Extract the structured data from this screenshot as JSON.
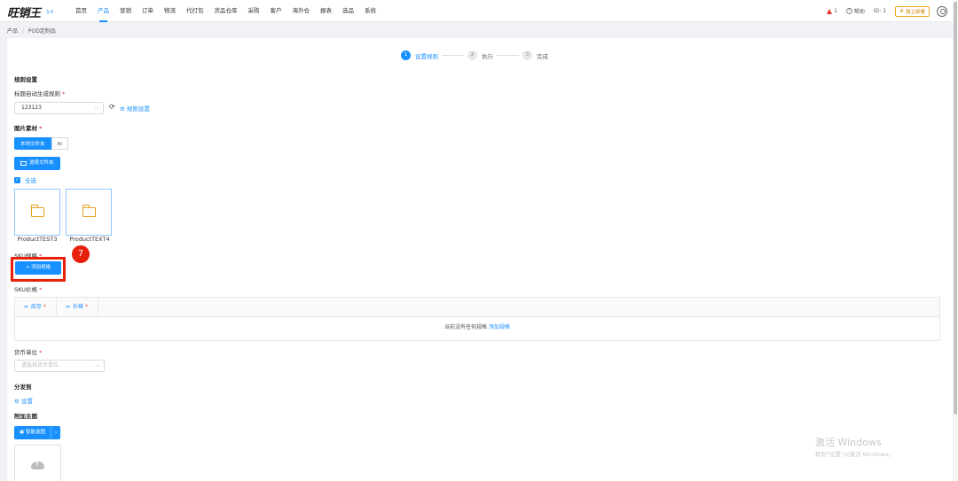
{
  "app": {
    "logo": "旺销王",
    "version": "3.0"
  },
  "nav": [
    {
      "label": "首页",
      "active": false
    },
    {
      "label": "产品",
      "active": true
    },
    {
      "label": "营销",
      "active": false
    },
    {
      "label": "订单",
      "active": false
    },
    {
      "label": "物流",
      "active": false
    },
    {
      "label": "代打包",
      "active": false
    },
    {
      "label": "货品仓库",
      "active": false
    },
    {
      "label": "采购",
      "active": false
    },
    {
      "label": "客户",
      "active": false
    },
    {
      "label": "海外仓",
      "active": false
    },
    {
      "label": "报表",
      "active": false
    },
    {
      "label": "选品",
      "active": false
    },
    {
      "label": "系统",
      "active": false
    }
  ],
  "topright": {
    "alert_count": "1",
    "help": "帮助",
    "id": "ID: 1",
    "deploy": "独立部署"
  },
  "breadcrumb": {
    "root": "产品",
    "sep": "/",
    "current": "POD定制品"
  },
  "steps": [
    {
      "num": "1",
      "label": "设置规则"
    },
    {
      "num": "2",
      "label": "执行"
    },
    {
      "num": "3",
      "label": "完成"
    }
  ],
  "rules": {
    "section": "规则设置",
    "title_rule_label": "标题自动生成规则",
    "title_rule_value": "123123",
    "rule_settings_link": "规则设置"
  },
  "image_material": {
    "label": "图片素材",
    "tabs": [
      "本地文件夹",
      "AI"
    ],
    "select_folder": "选择文件夹",
    "select_all": "全选",
    "folders": [
      "ProductTEST3",
      "ProductTEXT4"
    ]
  },
  "sku_spec": {
    "label": "SKU规格",
    "add_button": "+ 添加规格",
    "step_badge": "7"
  },
  "sku_price": {
    "label": "SKU价格",
    "columns": [
      "库存",
      "价格"
    ],
    "empty_text": "当前没有任何规格",
    "empty_link": "添加规格"
  },
  "currency": {
    "label": "货币单位",
    "placeholder": "请选择货币单位"
  },
  "distribute": {
    "label": "分发到",
    "settings_link": "设置"
  },
  "main_image": {
    "label": "附加主图",
    "smart_button": "智能选图"
  },
  "watermark": {
    "title": "激活 Windows",
    "subtitle": "转到\"设置\"以激活 Windows。"
  }
}
